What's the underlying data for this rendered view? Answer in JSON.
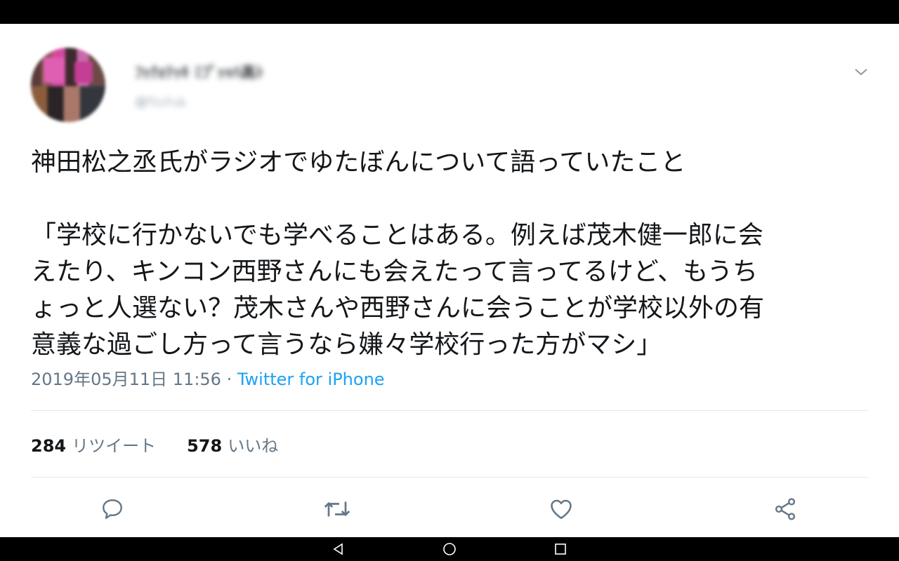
{
  "user": {
    "display_name": "ﾌｯｸｫﾃｯｷ ﾐﾌﾟｯｬﾊ髙ﾄ",
    "handle": "@ﾂｪｪﾄｪﾑ"
  },
  "tweet": {
    "lines": [
      "神田松之丞氏がラジオでゆたぼんについて語っていたこと",
      "",
      "「学校に行かないでも学べることはある。例えば茂木健一郎に会",
      "えたり、キンコン西野さんにも会えたって言ってるけど、もうち",
      "ょっと人選ない？茂木さんや西野さんに会うことが学校以外の有",
      "意義な過ごし方って言うなら嫌々学校行った方がマシ」"
    ],
    "timestamp": "2019年05月11日 11:56",
    "separator": " · ",
    "source": "Twitter for iPhone"
  },
  "stats": {
    "retweets_count": "284",
    "retweets_label": "リツイート",
    "likes_count": "578",
    "likes_label": "いいね"
  },
  "icons": {
    "menu": "chevron-down-icon",
    "reply": "reply-icon",
    "retweet": "retweet-icon",
    "like": "heart-icon",
    "share": "share-icon",
    "nav_back": "nav-back-icon",
    "nav_home": "nav-home-icon",
    "nav_recents": "nav-recents-icon"
  },
  "colors": {
    "accent": "#1da1f2",
    "secondary_text": "#657786",
    "primary_text": "#14171a",
    "divider": "#e1e8ed"
  }
}
